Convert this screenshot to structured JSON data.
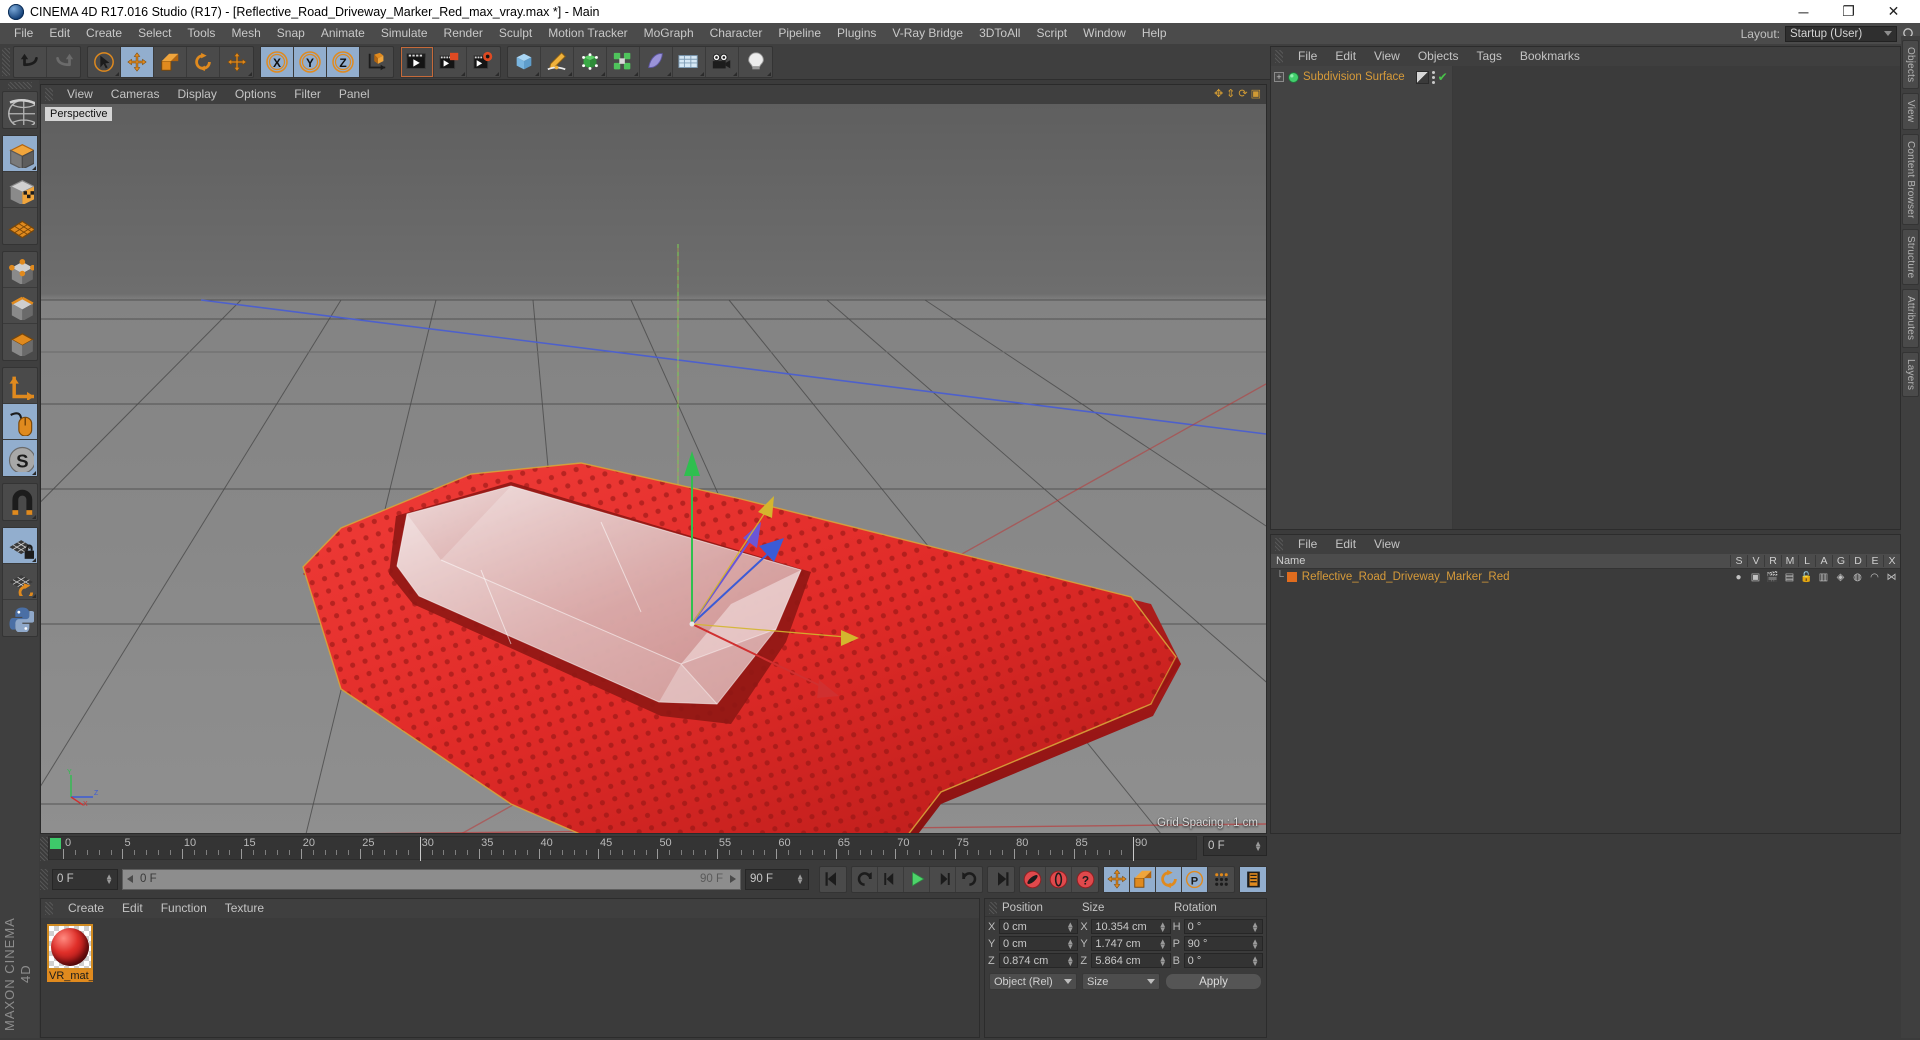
{
  "window": {
    "title": "CINEMA 4D R17.016 Studio (R17) - [Reflective_Road_Driveway_Marker_Red_max_vray.max *] - Main",
    "minimize": "─",
    "maximize": "❐",
    "close": "✕"
  },
  "menubar": {
    "items": [
      "File",
      "Edit",
      "Create",
      "Select",
      "Tools",
      "Mesh",
      "Snap",
      "Animate",
      "Simulate",
      "Render",
      "Sculpt",
      "Motion Tracker",
      "MoGraph",
      "Character",
      "Pipeline",
      "Plugins",
      "V-Ray Bridge",
      "3DToAll",
      "Script",
      "Window",
      "Help"
    ],
    "layout_label": "Layout:",
    "layout_value": "Startup (User)",
    "search_icon": "search-icon"
  },
  "toolbar": {
    "groups": [
      {
        "name": "undo-redo",
        "buttons": [
          {
            "name": "undo-button",
            "icon": "undo-icon",
            "selected": false
          },
          {
            "name": "redo-button",
            "icon": "redo-icon",
            "selected": false,
            "disabled": true
          }
        ]
      },
      {
        "name": "selection-transform",
        "buttons": [
          {
            "name": "live-selection-button",
            "icon": "live-selection-icon",
            "selected": false,
            "flyout": true
          },
          {
            "name": "move-button",
            "icon": "move-icon",
            "selected": true
          },
          {
            "name": "scale-button",
            "icon": "scale-icon",
            "selected": false
          },
          {
            "name": "rotate-button",
            "icon": "rotate-icon",
            "selected": false
          },
          {
            "name": "move-free-button",
            "icon": "move-axis-icon",
            "selected": false,
            "flyout": true
          }
        ]
      },
      {
        "name": "axis-locks",
        "buttons": [
          {
            "name": "lock-x-button",
            "icon": "axis-x-icon",
            "selected": true
          },
          {
            "name": "lock-y-button",
            "icon": "axis-y-icon",
            "selected": true
          },
          {
            "name": "lock-z-button",
            "icon": "axis-z-icon",
            "selected": true
          },
          {
            "name": "world-object-coordinates-button",
            "icon": "world-axis-icon",
            "selected": false
          }
        ]
      },
      {
        "name": "render-group",
        "buttons": [
          {
            "name": "render-view-button",
            "icon": "render-view-icon",
            "selected": false,
            "highlight": true
          },
          {
            "name": "render-region-button",
            "icon": "render-region-icon",
            "selected": false,
            "flyout": true
          },
          {
            "name": "render-settings-button",
            "icon": "render-settings-icon",
            "selected": false,
            "flyout": true
          }
        ]
      },
      {
        "name": "create-group",
        "buttons": [
          {
            "name": "add-cube-button",
            "icon": "cube-icon",
            "selected": false,
            "flyout": true
          },
          {
            "name": "add-spline-button",
            "icon": "pen-spline-icon",
            "selected": false,
            "flyout": true
          },
          {
            "name": "add-generator-button",
            "icon": "nurbs-icon",
            "selected": false,
            "flyout": true
          },
          {
            "name": "add-mograph-button",
            "icon": "mograph-icon",
            "selected": false,
            "flyout": true
          },
          {
            "name": "add-deformer-button",
            "icon": "deformer-icon",
            "selected": false,
            "flyout": true
          },
          {
            "name": "add-environment-button",
            "icon": "floor-environment-icon",
            "selected": false,
            "flyout": true
          },
          {
            "name": "add-camera-button",
            "icon": "camera-icon",
            "selected": false,
            "flyout": true
          },
          {
            "name": "add-light-button",
            "icon": "light-bulb-icon",
            "selected": false,
            "flyout": true
          }
        ]
      }
    ]
  },
  "leftbar": {
    "groups": [
      {
        "name": "mode-group-0",
        "buttons": [
          {
            "name": "make-editable-button",
            "icon": "globe-deform-icon",
            "selected": false
          }
        ]
      },
      {
        "name": "mode-group-1",
        "buttons": [
          {
            "name": "model-mode-button",
            "icon": "model-cube-icon",
            "selected": true,
            "flyout": true
          },
          {
            "name": "texture-mode-button",
            "icon": "texture-cube-icon",
            "selected": false
          },
          {
            "name": "workplane-mode-button",
            "icon": "workplane-grid-icon",
            "selected": false
          }
        ]
      },
      {
        "name": "component-group",
        "buttons": [
          {
            "name": "points-mode-button",
            "icon": "points-icon",
            "selected": false
          },
          {
            "name": "edges-mode-button",
            "icon": "edges-icon",
            "selected": false
          },
          {
            "name": "polygons-mode-button",
            "icon": "polygons-icon",
            "selected": false
          }
        ]
      },
      {
        "name": "tool-group",
        "buttons": [
          {
            "name": "enable-axis-button",
            "icon": "axis-l-icon",
            "selected": false
          },
          {
            "name": "enable-snapping-button",
            "icon": "mouse-icon",
            "selected": true
          },
          {
            "name": "soft-selection-button",
            "icon": "soft-selection-s-icon",
            "selected": true,
            "flyout": true
          }
        ]
      },
      {
        "name": "snap-group",
        "buttons": [
          {
            "name": "snap-magnet-button",
            "icon": "magnet-icon",
            "selected": false,
            "flyout": true
          }
        ]
      },
      {
        "name": "workplane-group",
        "buttons": [
          {
            "name": "lock-workplane-button",
            "icon": "workplane-lock-icon",
            "selected": true,
            "flyout": true
          },
          {
            "name": "align-workplane-button",
            "icon": "workplane-rotate-icon",
            "selected": false,
            "flyout": true
          },
          {
            "name": "python-script-button",
            "icon": "python-icon",
            "selected": false
          }
        ]
      }
    ],
    "brand": "MAXON CINEMA 4D"
  },
  "rightstrip": {
    "tabs": [
      "Objects",
      "View",
      "Content Browser",
      "Structure",
      "Attributes",
      "Layers"
    ]
  },
  "viewport": {
    "menu": [
      "View",
      "Cameras",
      "Display",
      "Options",
      "Filter",
      "Panel"
    ],
    "label": "Perspective",
    "grid_spacing": "Grid Spacing : 1 cm",
    "axis_labels": {
      "x": "X",
      "y": "Y",
      "z": "Z"
    },
    "nav_icons": [
      "pan-icon",
      "zoom-icon",
      "rotate-view-icon",
      "maximize-view-icon"
    ]
  },
  "object_manager": {
    "menu": [
      "File",
      "Edit",
      "View",
      "Objects",
      "Tags",
      "Bookmarks"
    ],
    "rows": [
      {
        "name": "Subdivision Surface",
        "icon": "subdivision-surface-icon",
        "expander": "+",
        "tags": [
          "display-tag",
          "dots-tag",
          "check-tag"
        ]
      }
    ]
  },
  "layer_manager": {
    "menu": [
      "File",
      "Edit",
      "View"
    ],
    "columns": [
      "Name",
      "S",
      "V",
      "R",
      "M",
      "L",
      "A",
      "G",
      "D",
      "E",
      "X"
    ],
    "rows": [
      {
        "name": "Reflective_Road_Driveway_Marker_Red",
        "color": "#e06c1e",
        "icons": [
          "solo-dot-icon",
          "visible-icon",
          "render-icon",
          "manager-icon",
          "lock-open-icon",
          "animation-icon",
          "generator-icon",
          "deformer-icon",
          "expression-icon",
          "xpresso-icon"
        ]
      }
    ]
  },
  "timeline": {
    "ticks": [
      0,
      5,
      10,
      15,
      20,
      25,
      30,
      35,
      40,
      45,
      50,
      55,
      60,
      65,
      70,
      75,
      80,
      85,
      90
    ],
    "current_frame_field": "0 F",
    "start_marker": 0
  },
  "animbar": {
    "current_frame": "0 F",
    "scrub_left": "0 F",
    "scrub_right": "90 F",
    "end_frame": "90 F",
    "transport": [
      {
        "name": "go-to-start-button",
        "icon": "skip-start-icon"
      },
      {
        "name": "previous-keyframe-button",
        "icon": "prev-key-icon"
      },
      {
        "name": "step-back-button",
        "icon": "step-back-icon"
      },
      {
        "name": "play-button",
        "icon": "play-icon"
      },
      {
        "name": "step-forward-button",
        "icon": "step-forward-icon"
      },
      {
        "name": "next-keyframe-button",
        "icon": "next-key-icon"
      },
      {
        "name": "go-to-end-button",
        "icon": "skip-end-icon"
      }
    ],
    "record": [
      {
        "name": "record-active-objects-button",
        "icon": "record-key-icon"
      },
      {
        "name": "autokeying-button",
        "icon": "autokey-icon"
      },
      {
        "name": "keyframe-selection-button",
        "icon": "key-question-icon"
      }
    ],
    "key_toggles": [
      {
        "name": "position-key-button",
        "icon": "move-icon",
        "selected": true
      },
      {
        "name": "scale-key-button",
        "icon": "scale-icon",
        "selected": true
      },
      {
        "name": "rotation-key-button",
        "icon": "rotate-icon",
        "selected": true
      },
      {
        "name": "parameter-key-button",
        "icon": "param-p-icon",
        "selected": true
      },
      {
        "name": "point-level-animation-button",
        "icon": "pla-dots-icon",
        "selected": false
      }
    ],
    "extra": [
      {
        "name": "timeline-toggle-button",
        "icon": "timeline-film-icon",
        "selected": true
      }
    ]
  },
  "material_manager": {
    "menu": [
      "Create",
      "Edit",
      "Function",
      "Texture"
    ],
    "materials": [
      {
        "name": "VR_mat_",
        "icon": "material-sphere-icon",
        "selected": true
      }
    ]
  },
  "coordinates": {
    "headers": [
      "Position",
      "Size",
      "Rotation"
    ],
    "position": [
      {
        "axis": "X",
        "value": "0 cm"
      },
      {
        "axis": "Y",
        "value": "0 cm"
      },
      {
        "axis": "Z",
        "value": "0.874 cm"
      }
    ],
    "size": [
      {
        "axis": "X",
        "value": "10.354 cm"
      },
      {
        "axis": "Y",
        "value": "1.747 cm"
      },
      {
        "axis": "Z",
        "value": "5.864 cm"
      }
    ],
    "rotation": [
      {
        "axis": "H",
        "value": "0 °"
      },
      {
        "axis": "P",
        "value": "90 °"
      },
      {
        "axis": "B",
        "value": "0 °"
      }
    ],
    "mode_select": "Object (Rel)",
    "size_select": "Size",
    "apply_button": "Apply"
  },
  "colors": {
    "accent_orange": "#e08a1e",
    "selection_blue": "#92aece",
    "object_text": "#d79b3a",
    "panel_bg": "#3b3b3b",
    "model_red": "#e03030"
  }
}
